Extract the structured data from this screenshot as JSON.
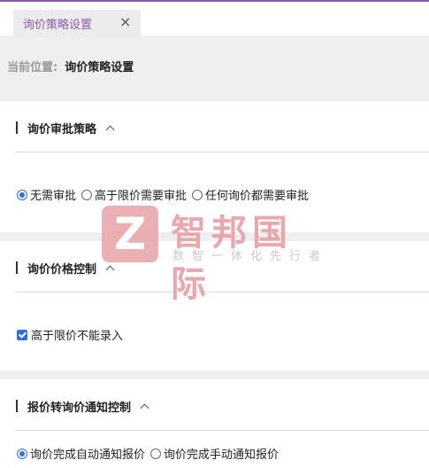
{
  "tab": {
    "label": "询价策略设置",
    "close": "×"
  },
  "breadcrumb": {
    "label": "当前位置:",
    "value": "询价策略设置"
  },
  "sections": [
    {
      "title": "询价审批策略",
      "options": [
        {
          "label": "无需审批",
          "checked": true
        },
        {
          "label": "高于限价需要审批",
          "checked": false
        },
        {
          "label": "任何询价都需要审批",
          "checked": false
        }
      ]
    },
    {
      "title": "询价价格控制",
      "checkbox": {
        "label": "高于限价不能录入",
        "checked": true
      }
    },
    {
      "title": "报价转询价通知控制",
      "options": [
        {
          "label": "询价完成自动通知报价",
          "checked": true
        },
        {
          "label": "询价完成手动通知报价",
          "checked": false
        }
      ]
    }
  ],
  "watermark": {
    "logo_letter": "Z",
    "name": "智邦国际",
    "slogan": "数智一体化先行者"
  },
  "colors": {
    "accent": "#8e5aa8",
    "control": "#2f6fe0"
  }
}
